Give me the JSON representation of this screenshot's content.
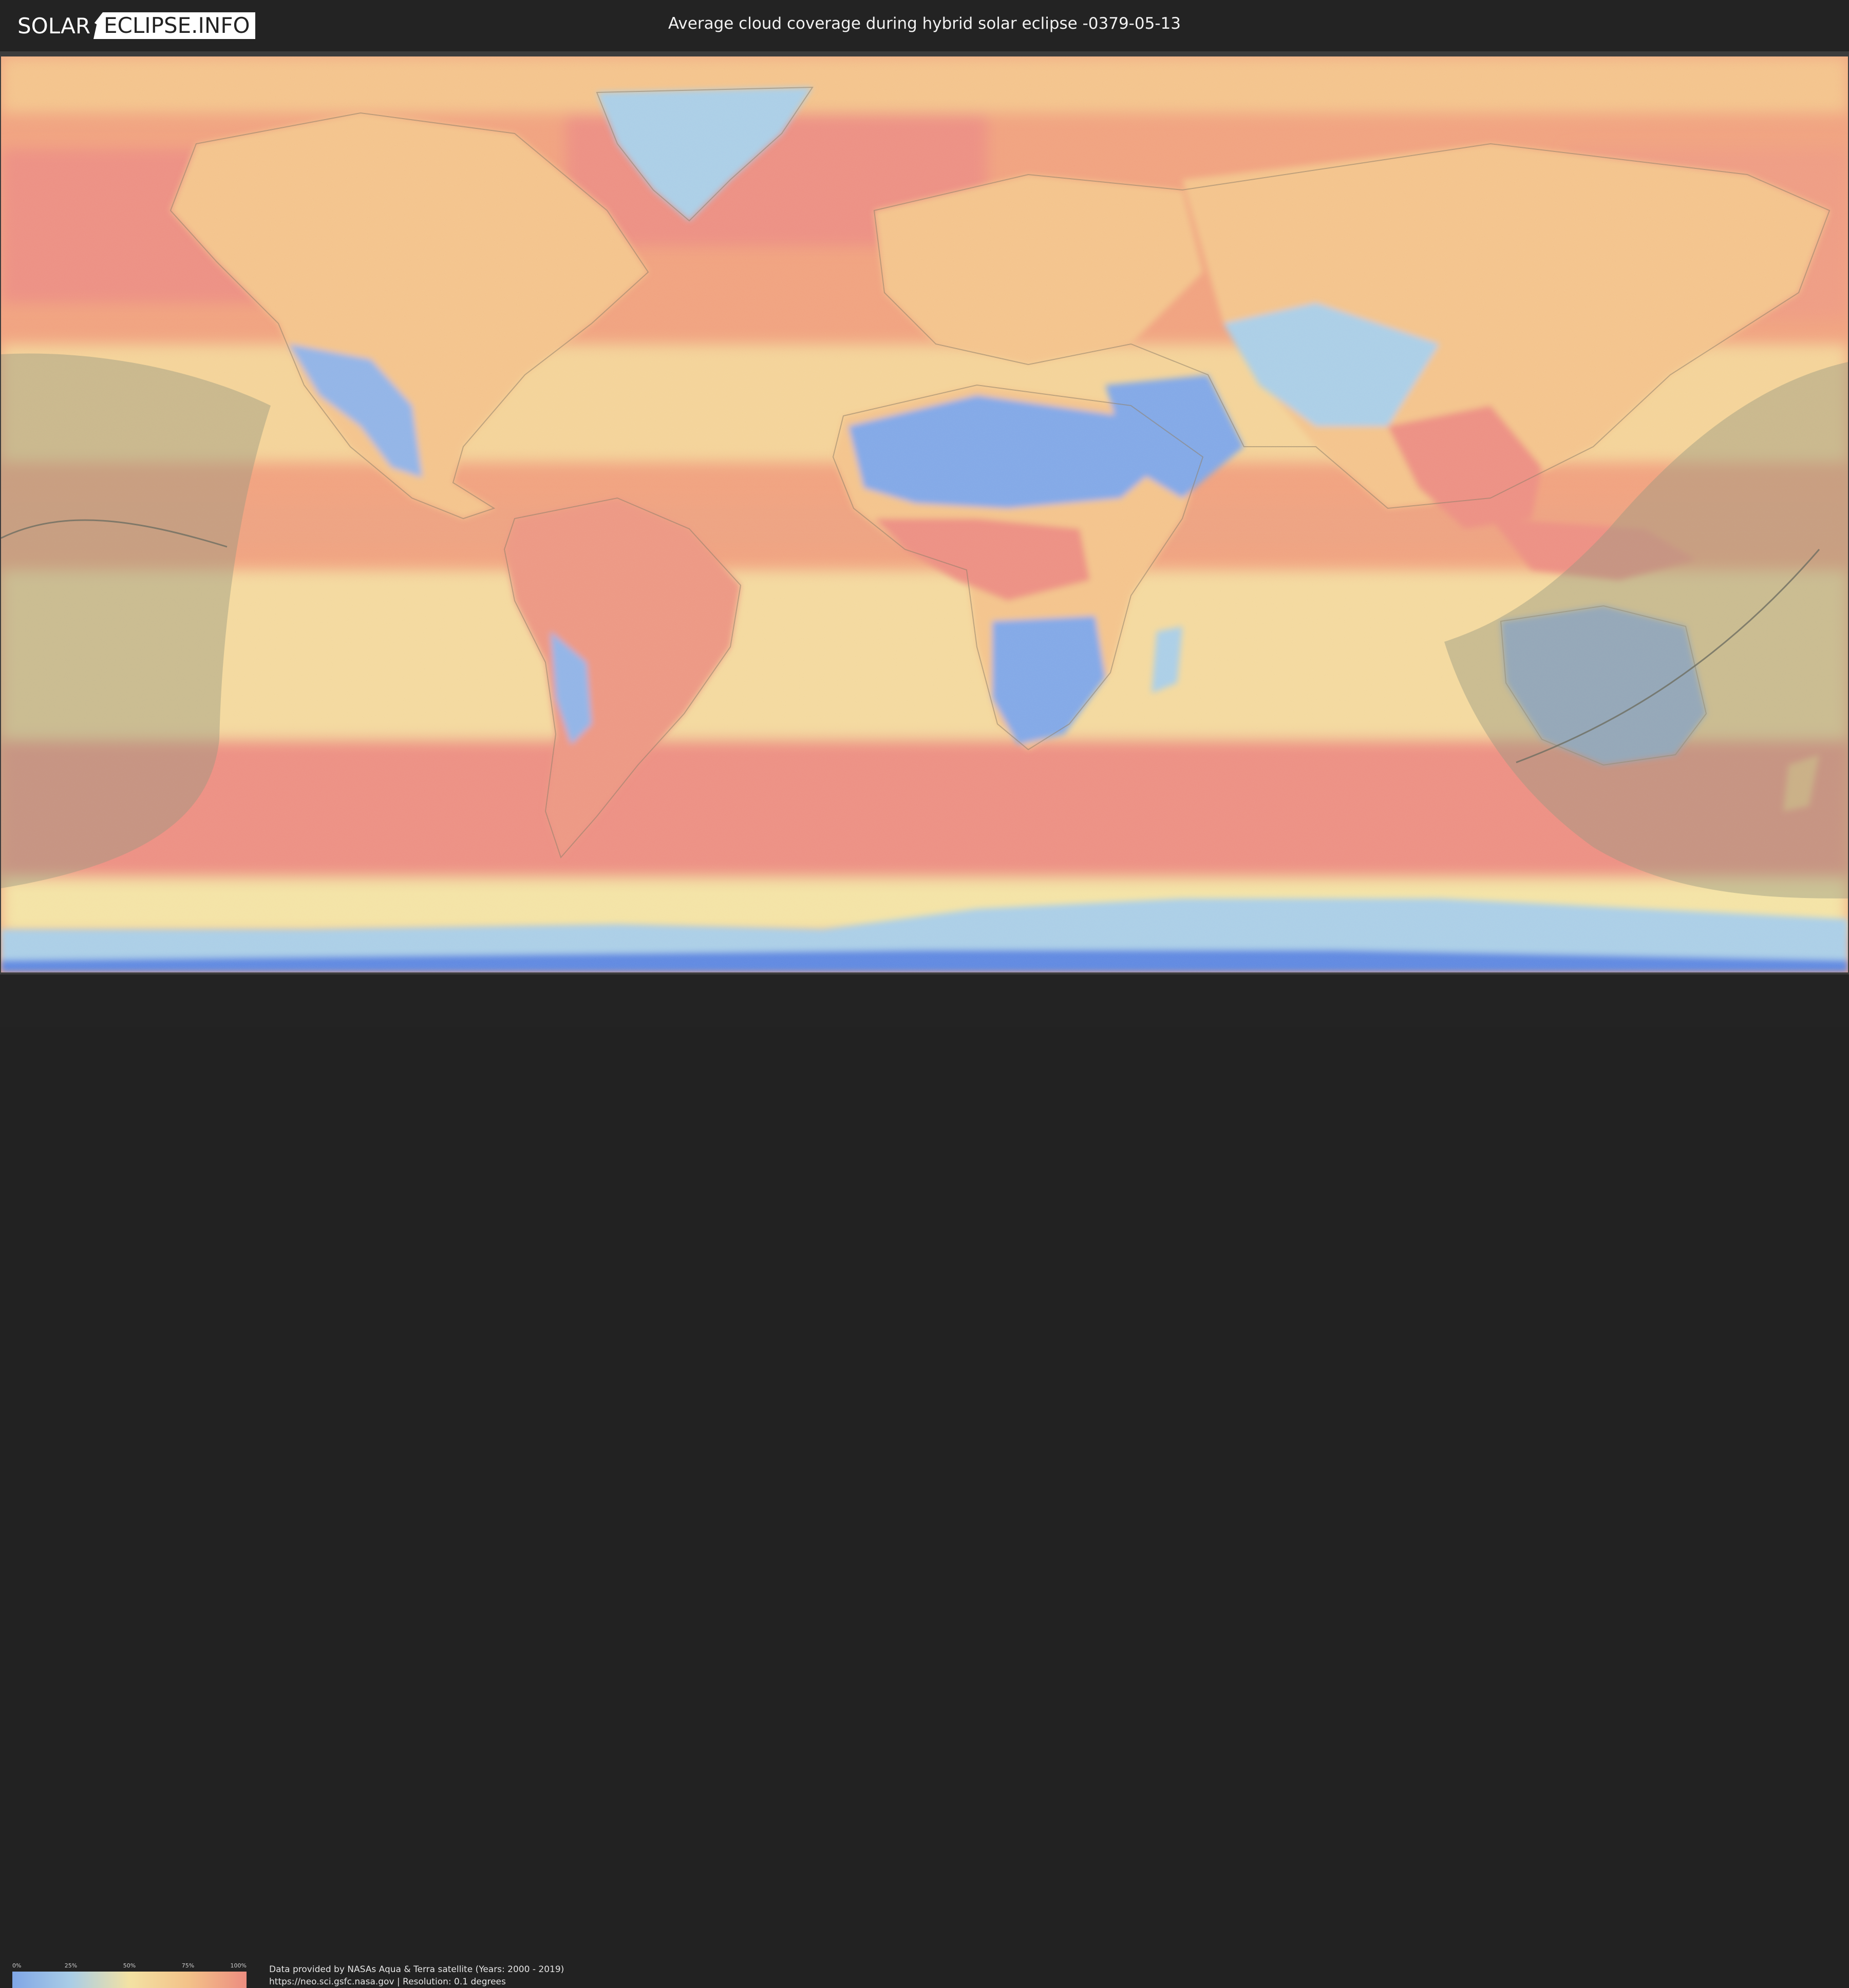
{
  "header": {
    "logo_part1": "SOLAR",
    "logo_part2": "ECLIPSE.INFO",
    "title": "Average cloud coverage during hybrid solar eclipse -0379-05-13"
  },
  "legend": {
    "ticks": [
      "0%",
      "25%",
      "50%",
      "75%",
      "100%"
    ],
    "tick_fractions": [
      0,
      0.25,
      0.5,
      0.75,
      1
    ],
    "gradient_colors": [
      "#7fa6e6",
      "#a9cde6",
      "#f3e2a3",
      "#f3c289",
      "#ec8d80"
    ]
  },
  "footer": {
    "credit_line1": "Data provided by NASAs Aqua & Terra satellite (Years: 2000 - 2019)",
    "credit_line2": "https://neo.sci.gsfc.nasa.gov | Resolution: 0.1 degrees"
  },
  "map": {
    "projection": "equirectangular",
    "colors": {
      "clear": "#7fa6e6",
      "low": "#a9cde6",
      "mid": "#f3e2a3",
      "high": "#f3c289",
      "overcast": "#ec8d80",
      "ice": "#5b86e0",
      "eclipse_shade": "#9a9a80",
      "central_line": "#6e6e62"
    }
  }
}
